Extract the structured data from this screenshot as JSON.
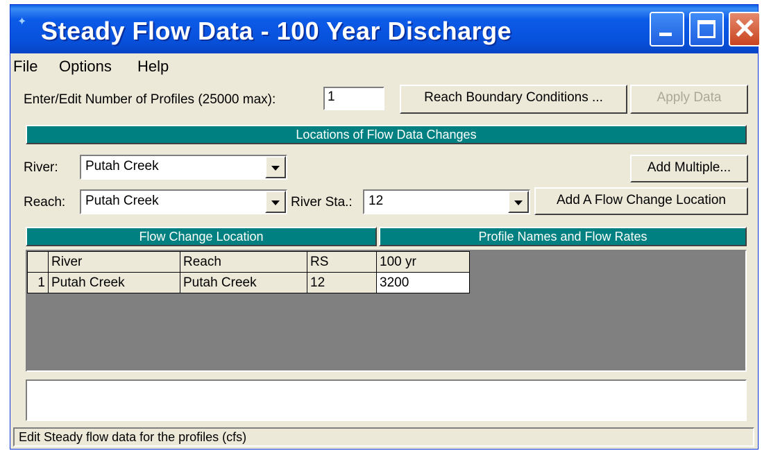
{
  "window": {
    "title": "Steady Flow Data - 100 Year Discharge"
  },
  "menu": {
    "file": "File",
    "options": "Options",
    "help": "Help"
  },
  "profiles": {
    "label": "Enter/Edit Number of Profiles (25000 max):",
    "value": "1"
  },
  "buttons": {
    "reach_boundary": "Reach Boundary Conditions ...",
    "apply_data": "Apply Data",
    "add_multiple": "Add Multiple...",
    "add_flow_change": "Add A Flow Change Location"
  },
  "locations_header": "Locations of Flow Data Changes",
  "river": {
    "label": "River:",
    "value": "Putah Creek"
  },
  "reach": {
    "label": "Reach:",
    "value": "Putah Creek"
  },
  "river_sta": {
    "label": "River Sta.:",
    "value": "12"
  },
  "table": {
    "left_header": "Flow Change Location",
    "right_header": "Profile Names and Flow Rates",
    "columns": [
      "River",
      "Reach",
      "RS",
      "100 yr"
    ],
    "rows": [
      {
        "index": "1",
        "river": "Putah Creek",
        "reach": "Putah Creek",
        "rs": "12",
        "flow": "3200"
      }
    ]
  },
  "status": "Edit Steady flow data for the profiles (cfs)",
  "colors": {
    "accent_header": "#008080",
    "titlebar": "#0852dd",
    "window_bg": "#ece9d8"
  }
}
